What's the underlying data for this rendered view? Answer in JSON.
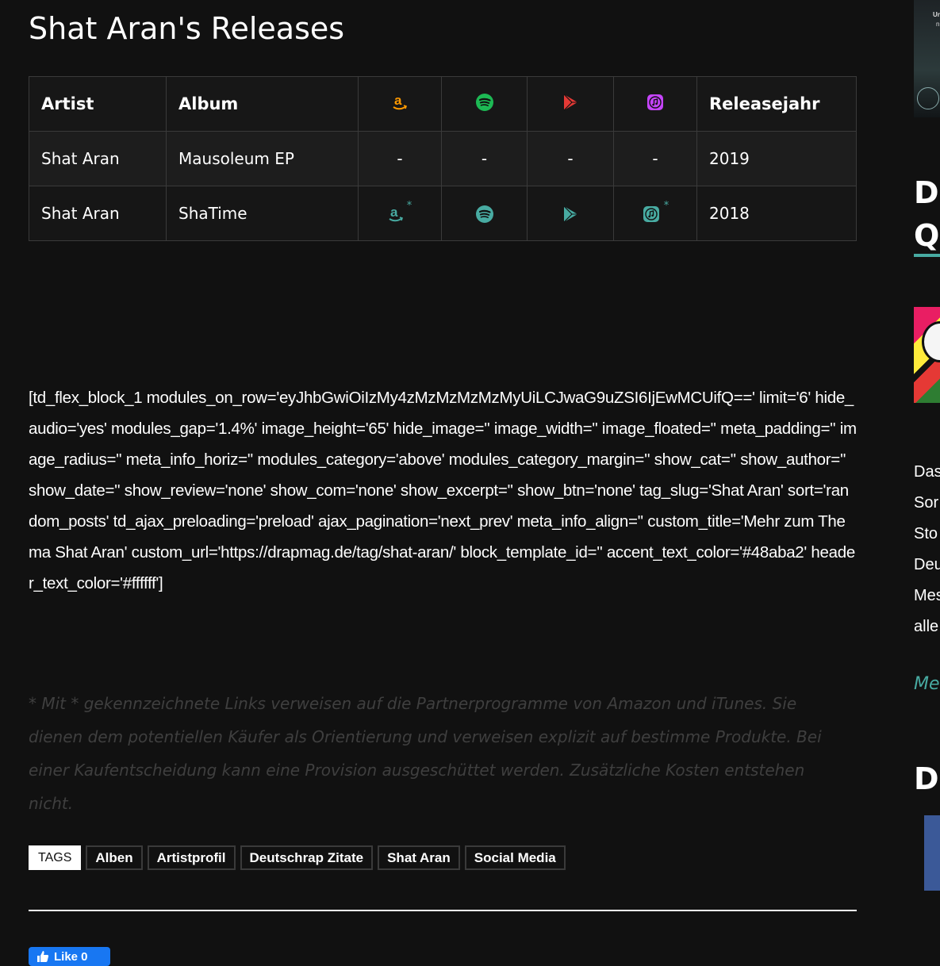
{
  "page_title": "Shat Aran's Releases",
  "table": {
    "headers": {
      "artist": "Artist",
      "album": "Album",
      "amazon_icon": "amazon-icon",
      "spotify_icon": "spotify-icon",
      "googleplay_icon": "google-play-icon",
      "itunes_icon": "itunes-icon",
      "year": "Releasejahr"
    },
    "rows": [
      {
        "artist": "Shat Aran",
        "album": "Mausoleum EP",
        "amazon": "-",
        "spotify": "-",
        "googleplay": "-",
        "itunes": "-",
        "year": "2019"
      },
      {
        "artist": "Shat Aran",
        "album": "ShaTime",
        "amazon_star": "*",
        "itunes_star": "*",
        "year": "2018"
      }
    ],
    "colors": {
      "amazon": "#ff9900",
      "spotify": "#1db954",
      "googleplay": "#e53935",
      "itunes": "#c644fc",
      "accent": "#48aba2"
    }
  },
  "shortcode_text": "[td_flex_block_1 modules_on_row='eyJhbGwiOiIzMy4zMzMzMzMzMyUiLCJwaG9uZSI6IjEwMCUifQ==' limit='6' hide_audio='yes' modules_gap='1.4%' image_height='65' hide_image='' image_width='' image_floated='' meta_padding='' image_radius='' meta_info_horiz='' modules_category='above' modules_category_margin='' show_cat='' show_author='' show_date='' show_review='none' show_com='none' show_excerpt='' show_btn='none' tag_slug='Shat Aran' sort='random_posts' td_ajax_preloading='preload' ajax_pagination='next_prev' meta_info_align='' custom_title='Mehr zum Thema Shat Aran' custom_url='https://drapmag.de/tag/shat-aran/' block_template_id='' accent_text_color='#48aba2' header_text_color='#ffffff']",
  "disclaimer": "* Mit * gekennzeichnete Links verweisen auf die Partnerprogramme von Amazon und iTunes. Sie dienen dem potentiellen Käufer als Orientierung und verweisen explizit auf bestimme Produkte. Bei einer Kaufentscheidung kann eine Provision ausgeschüttet werden. Zusätzliche Kosten entstehen nicht.",
  "tags": {
    "label": "TAGS",
    "items": [
      "Alben",
      "Artistprofil",
      "Deutschrap Zitate",
      "Shat Aran",
      "Social Media"
    ]
  },
  "like_button": {
    "label": "Like 0",
    "color": "#1877f2"
  },
  "sidebar": {
    "thumb_text_1": "Un",
    "thumb_text_2": "ni",
    "heading_1_line_1": "Da",
    "heading_1_line_2": "Qu",
    "text_lines": [
      "Das",
      "Sor",
      "Sto",
      "Deu",
      "Mes",
      "alle"
    ],
    "more_link": "Me",
    "heading_2": "Dr"
  }
}
